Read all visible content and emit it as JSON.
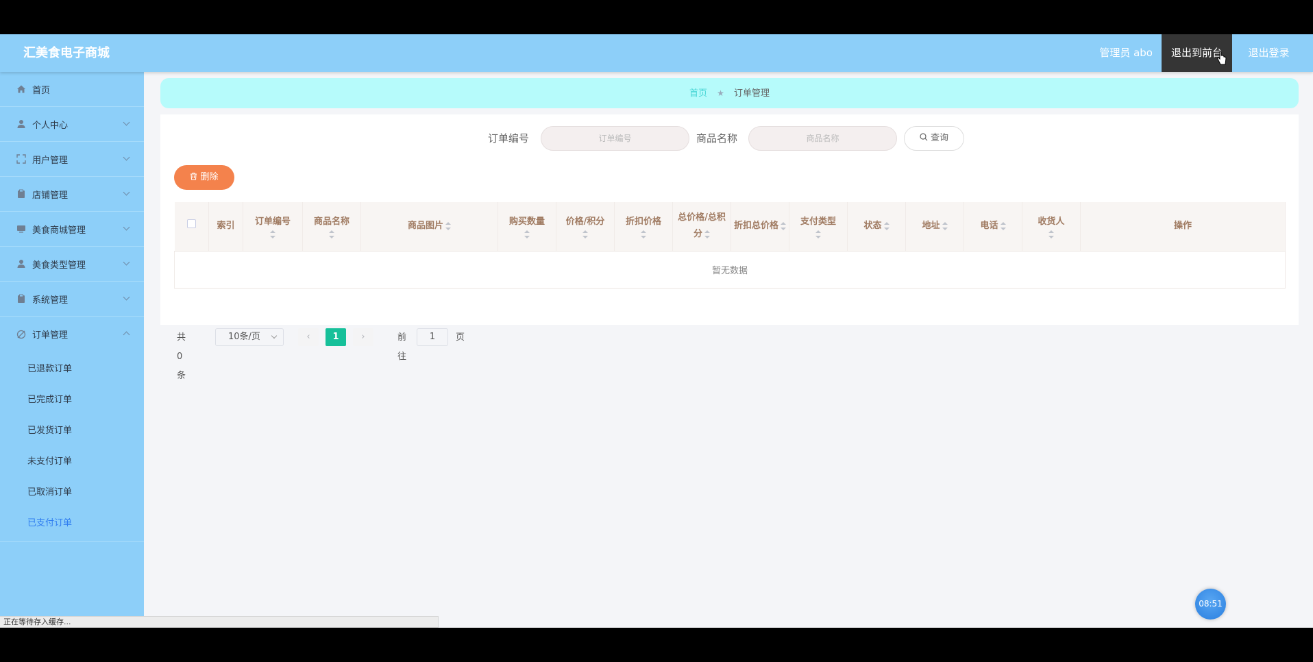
{
  "header": {
    "brand": "汇美食电子商城",
    "admin_label": "管理员 abo",
    "exit_front_label": "退出到前台",
    "logout_label": "退出登录",
    "bg_color": "#8dcff9"
  },
  "sidebar": {
    "items": [
      {
        "label": "首页",
        "icon": "home-icon"
      },
      {
        "label": "个人中心",
        "icon": "user-icon"
      },
      {
        "label": "用户管理",
        "icon": "expand-icon"
      },
      {
        "label": "店铺管理",
        "icon": "clipboard-icon"
      },
      {
        "label": "美食商城管理",
        "icon": "monitor-icon"
      },
      {
        "label": "美食类型管理",
        "icon": "user-icon"
      },
      {
        "label": "系统管理",
        "icon": "clipboard-icon"
      },
      {
        "label": "订单管理",
        "icon": "slash-icon"
      }
    ],
    "sub_items": [
      "已退款订单",
      "已完成订单",
      "已发货订单",
      "未支付订单",
      "已取消订单",
      "已支付订单"
    ],
    "active_sub": "已支付订单"
  },
  "breadcrumb": {
    "home": "首页",
    "current": "订单管理"
  },
  "search": {
    "order_no_label": "订单编号",
    "order_no_placeholder": "订单编号",
    "product_name_label": "商品名称",
    "product_name_placeholder": "商品名称",
    "query_label": "查询"
  },
  "toolbar": {
    "delete_label": "删除"
  },
  "table": {
    "columns": [
      "索引",
      "订单编号",
      "商品名称",
      "商品图片",
      "购买数量",
      "价格/积分",
      "折扣价格",
      "总价格/总积分",
      "折扣总价格",
      "支付类型",
      "状态",
      "地址",
      "电话",
      "收货人",
      "操作"
    ],
    "empty_text": "暂无数据"
  },
  "pagination": {
    "total_text": "共 0 条",
    "page_size": "10条/页",
    "current_page": "1",
    "goto_label": "前往",
    "goto_value": "1",
    "page_suffix": "页"
  },
  "clock": "08:51",
  "status_bar": "正在等待存入缓存..."
}
